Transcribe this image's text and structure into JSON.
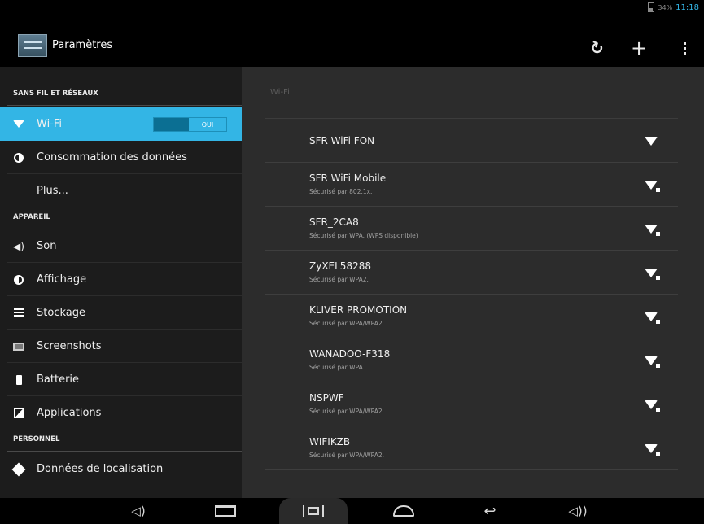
{
  "status_bar": {
    "battery": "34%",
    "time": "11:18",
    "clock_color": "#33b5e5"
  },
  "action_bar": {
    "title": "Paramètres",
    "icon": "settings-app-icon",
    "actions": [
      {
        "name": "refresh-wps-icon",
        "glyph": "↻"
      },
      {
        "name": "add-network-icon",
        "glyph": "+"
      },
      {
        "name": "overflow-menu-icon",
        "glyph": "⋮"
      }
    ]
  },
  "accent_color": "#33b5e5",
  "sidebar": {
    "sections": [
      {
        "header": "SANS FIL ET RÉSEAUX",
        "items": [
          {
            "label": "Wi-Fi",
            "icon": "wifi-icon",
            "selected": true,
            "toggle": "OUI"
          },
          {
            "label": "Consommation des données",
            "icon": "data-usage-icon"
          },
          {
            "label": "Plus...",
            "icon": ""
          }
        ]
      },
      {
        "header": "APPAREIL",
        "items": [
          {
            "label": "Son",
            "icon": "volume-icon"
          },
          {
            "label": "Affichage",
            "icon": "display-icon"
          },
          {
            "label": "Stockage",
            "icon": "storage-icon"
          },
          {
            "label": "Screenshots",
            "icon": "screenshot-icon"
          },
          {
            "label": "Batterie",
            "icon": "battery-icon"
          },
          {
            "label": "Applications",
            "icon": "apps-icon"
          }
        ]
      },
      {
        "header": "PERSONNEL",
        "items": [
          {
            "label": "Données de localisation",
            "icon": "location-icon"
          }
        ]
      }
    ]
  },
  "detail": {
    "title": "Wi-Fi",
    "networks": [
      {
        "name": "SFR WiFi FON",
        "subtitle": "",
        "secured": false
      },
      {
        "name": "SFR WiFi Mobile",
        "subtitle": "Sécurisé par 802.1x.",
        "secured": true
      },
      {
        "name": "SFR_2CA8",
        "subtitle": "Sécurisé par WPA. (WPS disponible)",
        "secured": true
      },
      {
        "name": "ZyXEL58288",
        "subtitle": "Sécurisé par WPA2.",
        "secured": true
      },
      {
        "name": "KLIVER PROMOTION",
        "subtitle": "Sécurisé par WPA/WPA2.",
        "secured": true
      },
      {
        "name": "WANADOO-F318",
        "subtitle": "Sécurisé par WPA.",
        "secured": true
      },
      {
        "name": "NSPWF",
        "subtitle": "Sécurisé par WPA/WPA2.",
        "secured": true
      },
      {
        "name": "WIFIKZB",
        "subtitle": "Sécurisé par WPA/WPA2.",
        "secured": true
      }
    ]
  },
  "nav_bar": {
    "buttons": [
      "volume-down-icon",
      "recent-apps-icon",
      "screenshot-button-icon",
      "home-icon",
      "back-icon",
      "volume-up-icon"
    ]
  }
}
